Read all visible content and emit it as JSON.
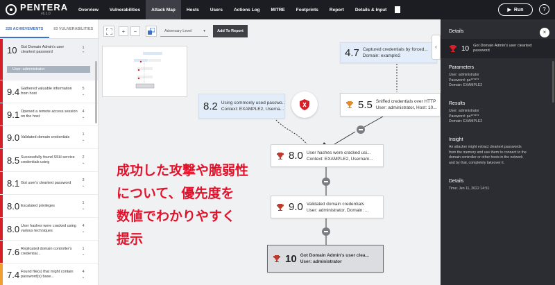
{
  "app": {
    "logo": "PENTERA",
    "version": "v6.1.0"
  },
  "nav": [
    {
      "label": "Overview",
      "active": false
    },
    {
      "label": "Vulnerabilities",
      "active": false
    },
    {
      "label": "Attack Map",
      "active": true
    },
    {
      "label": "Hosts",
      "active": false
    },
    {
      "label": "Users",
      "active": false
    },
    {
      "label": "Actions Log",
      "active": false
    },
    {
      "label": "MITRE",
      "active": false
    },
    {
      "label": "Footprints",
      "active": false
    },
    {
      "label": "Report",
      "active": false
    },
    {
      "label": "Details & Input",
      "active": false
    }
  ],
  "run_label": "Run",
  "help_label": "?",
  "left": {
    "tabs": [
      "226 ACHIEVEMENTS",
      "63 VULNERABILITIES"
    ],
    "first": {
      "score": "10",
      "desc": "Got Domain Admin's user cleartext password",
      "count": "1",
      "user": "User: administrator"
    },
    "items": [
      {
        "score": "9.4",
        "desc": "Gathered valuable information from host",
        "count": "5"
      },
      {
        "score": "9.1",
        "desc": "Opened a remote access session on the host",
        "count": "4"
      },
      {
        "score": "9.0",
        "desc": "Validated domain credentials",
        "count": "1"
      },
      {
        "score": "8.5",
        "desc": "Successfully found SSH service credentials using",
        "count": "2"
      },
      {
        "score": "8.1",
        "desc": "Got user's cleartext password",
        "count": "3"
      },
      {
        "score": "8.0",
        "desc": "Escalated privileges",
        "count": "1"
      },
      {
        "score": "8.0",
        "desc": "User hashes were cracked using various techniques",
        "count": "4"
      },
      {
        "score": "7.6",
        "desc": "Replicated domain controller's credential...",
        "count": "1"
      },
      {
        "score": "7.4",
        "desc": "Found file(s) that might contain password(s) base...",
        "count": "4"
      }
    ]
  },
  "toolbar": {
    "fit_icon": "fit-icon",
    "zoom_in": "+",
    "zoom_out": "−",
    "adversary": "Adversary Level",
    "add_report": "Add To Report"
  },
  "nodes": {
    "n1": {
      "score": "4.7",
      "l1": "Captured credentials by forced...",
      "l2": "Domain: example2"
    },
    "n2": {
      "score": "8.2",
      "l1": "Using commonly used passwo...",
      "l2": "Context: EXAMPLE2, Userna..."
    },
    "n3": {
      "score": "5.5",
      "l1": "Sniffed credentials over HTTP",
      "l2": "User: administrator, Host: 10..."
    },
    "n4": {
      "score": "8.0",
      "l1": "User hashes were cracked usi...",
      "l2": "Context: EXAMPLE2, Usernam..."
    },
    "n5": {
      "score": "9.0",
      "l1": "Validated domain credentials",
      "l2": "User: administrator, Domain: ..."
    },
    "n6": {
      "score": "10",
      "l1": "Got Domain Admin's user clea...",
      "l2": "User: administrator"
    }
  },
  "overlay": {
    "line1": "成功した攻撃や脆弱性",
    "line2": "について、優先度を",
    "line3": "数値でわかりやすく",
    "line4": "提示"
  },
  "right": {
    "header": "Details",
    "close": "×",
    "card": {
      "score": "10",
      "title": "Got Domain Admin's user cleartext password"
    },
    "parameters": {
      "title": "Parameters",
      "lines": [
        "User: administrator",
        "Password: pa******",
        "Domain: EXAMPLE2"
      ]
    },
    "results": {
      "title": "Results",
      "lines": [
        "User: administrator",
        "Password: pa******",
        "Domain: EXAMPLE2"
      ]
    },
    "insight": {
      "title": "Insight",
      "lines": [
        "An attacker might extract cleartext passwords",
        "from the memory and use them to connect to the",
        "domain controller or other hosts in the network",
        "and by that, completely takeover it."
      ]
    },
    "details": {
      "title": "Details",
      "lines": [
        "Time: Jan 11, 2022 14:51"
      ]
    }
  },
  "colors": {
    "critical": "#d61f26",
    "high": "#f0a030",
    "accent": "#3c72c4",
    "trophy": "#c0392b"
  }
}
